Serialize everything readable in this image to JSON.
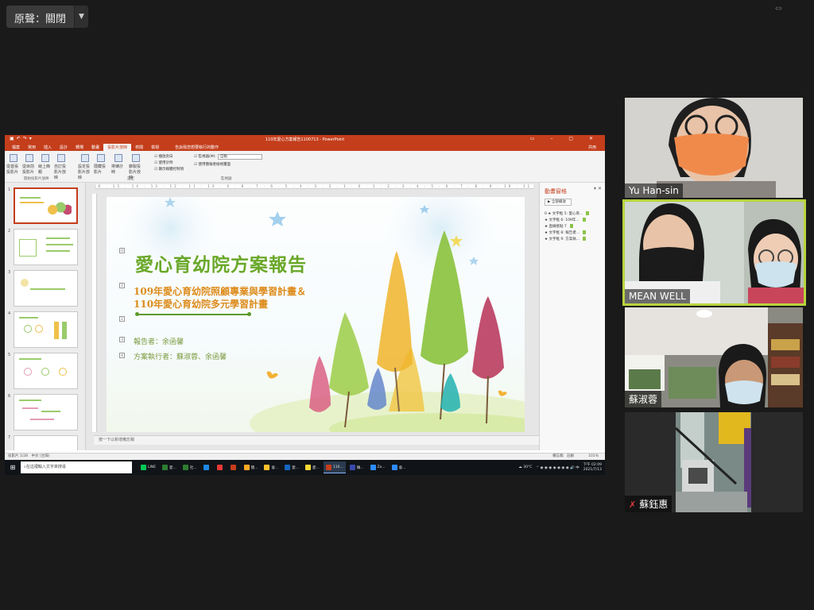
{
  "zoom": {
    "sound_label": "原聲：關閉",
    "sound_dropdown_icon": "chevron-down-icon"
  },
  "powerpoint": {
    "window_title": "110年愛心方案報告1100713 - PowerPoint",
    "tabs": [
      "檔案",
      "常用",
      "插入",
      "設計",
      "轉場",
      "動畫",
      "投影片放映",
      "校閱",
      "檢視"
    ],
    "active_tab": "投影片放映",
    "tell_me": "告訴我您想要執行的動作",
    "share": "共用",
    "ribbon": {
      "buttons": [
        "從首張投影片",
        "從目前投影片",
        "線上簡報",
        "自訂投影片放映",
        "設定投影片放映",
        "隱藏投影片",
        "排練計時",
        "錄製投影片放映"
      ],
      "checkboxes": [
        "播放旁白",
        "使用計時",
        "顯示媒體控制項",
        "使用簡報者檢視畫面"
      ],
      "monitor_label": "監視器(M):",
      "monitor_value": "自動",
      "groups": [
        "開始投影片放映",
        "設定",
        "監視器"
      ]
    },
    "slide": {
      "title": "愛心育幼院方案報告",
      "subtitle_1": "109年愛心育幼院照顧專業與學習計畫＆",
      "subtitle_2": "110年愛心育幼院多元學習計畫",
      "reporter": "報告者：余函馨",
      "executor": "方案執行者：蘇淑蓉、余函馨"
    },
    "thumb_numbers": [
      "1",
      "2",
      "3",
      "4",
      "5",
      "6",
      "7"
    ],
    "notes_placeholder": "按一下以新增備忘稿",
    "animation_pane": {
      "title": "動畫窗格",
      "play_label": "全部播放",
      "items": [
        "0 ★ 文字框 5: 愛心育...",
        "★ 文字框 6: 109年...",
        "★ 直線接點 7",
        "★ 文字框 8: 報告者...",
        "★ 文字框 9: 方案執..."
      ]
    },
    "status_left": "投影片 1/28　中文 (台灣)",
    "status_right": "備忘稿　註解　　　　101%",
    "ruler_text": "16 · 15 · 14 · 13 · 12 · 11 · 10 · 9 · 8 · 7 · 6 · 5 · 4 · 3 · 2 · 1 · 0 · 1 · 2 · 3 · 4 · 5 · 6 · 7 · 8 · 9 · 10 · 11 · 12 · 13 · 14 · 15 · 16"
  },
  "taskbar": {
    "search_placeholder": "在這裡輸入文字來搜尋",
    "apps": [
      {
        "label": "LINE",
        "color": "#06c755"
      },
      {
        "label": "愛...",
        "color": "#2e7d32"
      },
      {
        "label": "社...",
        "color": "#2e7d32"
      },
      {
        "label": "",
        "color": "#1e88e5"
      },
      {
        "label": "",
        "color": "#e53935"
      },
      {
        "label": "",
        "color": "#c43e1c"
      },
      {
        "label": "閱...",
        "color": "#f9a825"
      },
      {
        "label": "會...",
        "color": "#fbc02d"
      },
      {
        "label": "愛...",
        "color": "#1565c0"
      },
      {
        "label": "愛...",
        "color": "#fdd835"
      },
      {
        "label": "110...",
        "color": "#c43e1c"
      },
      {
        "label": "賴...",
        "color": "#3949ab"
      },
      {
        "label": "Zo...",
        "color": "#2d8cff"
      },
      {
        "label": "會...",
        "color": "#2d8cff"
      }
    ],
    "weather": "30°C",
    "time": "下午 02:09",
    "date": "2021/7/13"
  },
  "participants": [
    {
      "name": "Yu Han-sin",
      "muted": false,
      "speaking": false
    },
    {
      "name": "MEAN WELL",
      "muted": false,
      "speaking": true
    },
    {
      "name": "蘇淑蓉",
      "muted": false,
      "speaking": false
    },
    {
      "name": "蘇鈺惠",
      "muted": true,
      "speaking": false
    }
  ]
}
